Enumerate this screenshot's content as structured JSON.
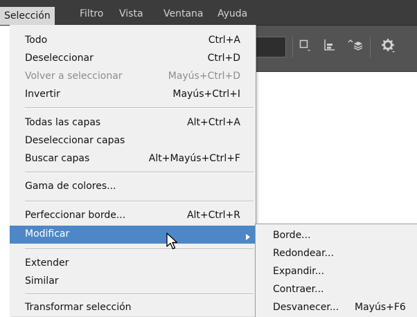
{
  "menubar": {
    "items": [
      "Selección",
      "Filtro",
      "Vista",
      "Ventana",
      "Ayuda"
    ]
  },
  "toolbar": {
    "icons": [
      "rectangle-dropdown-icon",
      "align-bottom-icon",
      "layer-arrange-icon",
      "gear-icon"
    ]
  },
  "dropdown": {
    "items": [
      {
        "label": "Todo",
        "shortcut": "Ctrl+A"
      },
      {
        "label": "Deseleccionar",
        "shortcut": "Ctrl+D"
      },
      {
        "label": "Volver a seleccionar",
        "shortcut": "Mayús+Ctrl+D",
        "disabled": true
      },
      {
        "label": "Invertir",
        "shortcut": "Mayús+Ctrl+I"
      },
      {
        "label": "Todas las capas",
        "shortcut": "Alt+Ctrl+A"
      },
      {
        "label": "Deseleccionar capas",
        "shortcut": ""
      },
      {
        "label": "Buscar capas",
        "shortcut": "Alt+Mayús+Ctrl+F"
      },
      {
        "label": "Gama de colores...",
        "shortcut": ""
      },
      {
        "label": "Perfeccionar borde...",
        "shortcut": "Alt+Ctrl+R"
      },
      {
        "label": "Modificar",
        "shortcut": "",
        "highlighted": true,
        "submenu": true
      },
      {
        "label": "Extender",
        "shortcut": ""
      },
      {
        "label": "Similar",
        "shortcut": ""
      },
      {
        "label": "Transformar selección",
        "shortcut": ""
      }
    ]
  },
  "submenu": {
    "items": [
      {
        "label": "Borde...",
        "shortcut": ""
      },
      {
        "label": "Redondear...",
        "shortcut": ""
      },
      {
        "label": "Expandir...",
        "shortcut": ""
      },
      {
        "label": "Contraer...",
        "shortcut": ""
      },
      {
        "label": "Desvanecer...",
        "shortcut": "Mayús+F6"
      }
    ]
  },
  "colors": {
    "menubar": "#3c3c3c",
    "highlight": "#4d87c7",
    "menu_bg": "#f0f0f0",
    "disabled_text": "#8d8d8d"
  }
}
